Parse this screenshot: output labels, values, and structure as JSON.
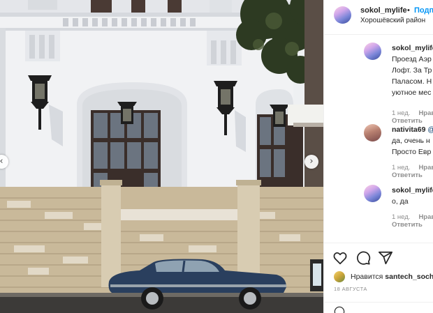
{
  "header": {
    "username": "sokol_mylife",
    "separator": "•",
    "follow_label": "Подпи",
    "location": "Хорошёвский район"
  },
  "photo": {
    "prev_icon": "chevron-left-icon",
    "next_icon": "chevron-right-icon",
    "prev_glyph": "‹",
    "next_glyph": "›"
  },
  "comments": [
    {
      "username": "sokol_mylife",
      "lines": [
        "Проезд Аэр",
        "Лофт. За Тр",
        "Паласом. Н",
        "уютное мес"
      ],
      "time": "1 нед.",
      "likes": "Нрав",
      "reply": "Ответить"
    },
    {
      "username": "nativita69",
      "mention": "@",
      "lines": [
        "да, очень н",
        "Просто Евр"
      ],
      "time": "1 нед.",
      "likes": "Нрав",
      "reply": "Ответить"
    },
    {
      "username": "sokol_mylife",
      "lines": [
        "о, да"
      ],
      "time": "1 нед.",
      "likes": "Нрав",
      "reply": "Ответить"
    }
  ],
  "actions": {
    "icons": [
      "heart-icon",
      "comment-icon",
      "share-icon"
    ],
    "liked_by_prefix": "Нравится",
    "liked_by_user": "santech_sochi",
    "date": "18 августа"
  },
  "colors": {
    "link": "#0095f6",
    "muted": "#8e8e8e",
    "text": "#262626",
    "border": "#efefef"
  }
}
